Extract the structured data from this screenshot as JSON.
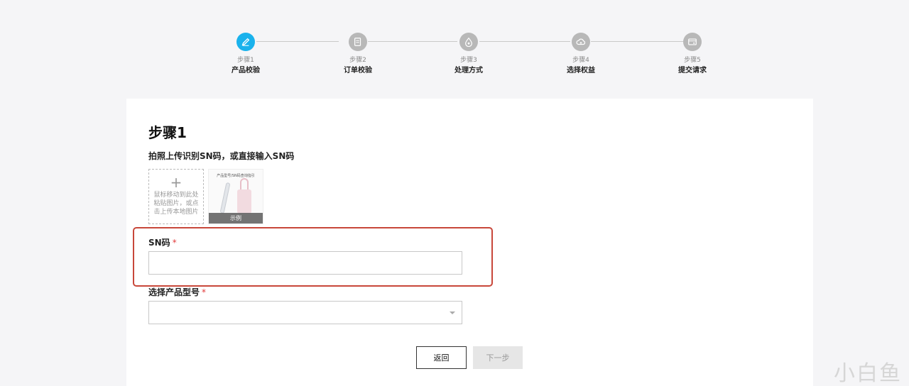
{
  "stepper": {
    "steps": [
      {
        "num": "步骤1",
        "name": "产品校验",
        "icon": "pencil-icon",
        "active": true
      },
      {
        "num": "步骤2",
        "name": "订单校验",
        "icon": "document-icon",
        "active": false
      },
      {
        "num": "步骤3",
        "name": "处理方式",
        "icon": "drop-icon",
        "active": false
      },
      {
        "num": "步骤4",
        "name": "选择权益",
        "icon": "cloud-icon",
        "active": false
      },
      {
        "num": "步骤5",
        "name": "提交请求",
        "icon": "card-icon",
        "active": false
      }
    ]
  },
  "form": {
    "title": "步骤1",
    "upload_hint": "拍照上传识别SN码，或直接输入SN码",
    "upload_plus": "+",
    "upload_tip": "鼠标移动到此处粘贴图片，或点击上传本地图片",
    "sample_header": "产品型号/SN码查询指引",
    "sample_label": "示例",
    "sn_label": "SN码",
    "sn_value": "",
    "model_label": "选择产品型号",
    "model_value": "",
    "required_mark": "*",
    "back_button": "返回",
    "next_button": "下一步"
  },
  "watermark": "小白鱼",
  "colors": {
    "accent": "#1ab2ec",
    "inactive_step": "#b8b8b8",
    "required": "#e23b3b",
    "highlight": "#c8473a"
  }
}
